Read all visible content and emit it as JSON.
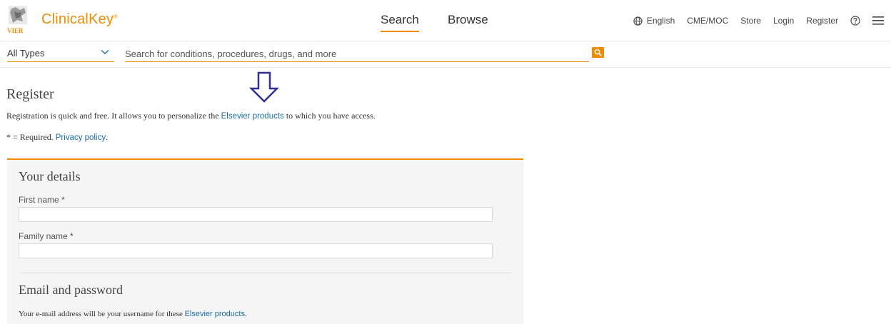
{
  "header": {
    "logo_text": "VIER",
    "brand": "ClinicalKey",
    "brand_mark": "®",
    "nav": {
      "search": "Search",
      "browse": "Browse"
    },
    "links": {
      "language": "English",
      "cme": "CME/MOC",
      "store": "Store",
      "login": "Login",
      "register": "Register"
    },
    "icons": {
      "globe": "globe-icon",
      "help": "help-icon",
      "menu": "menu-icon"
    }
  },
  "searchbar": {
    "type_value": "All Types",
    "placeholder": "Search for conditions, procedures, drugs, and more"
  },
  "page": {
    "title": "Register",
    "intro_before": "Registration is quick and free. It allows you to personalize the ",
    "intro_link": "Elsevier products",
    "intro_after": " to which you have access.",
    "required_prefix": "* = Required. ",
    "privacy_link": "Privacy policy",
    "required_suffix": "."
  },
  "form": {
    "details_title": "Your details",
    "first_name_label": "First name *",
    "family_name_label": "Family name *",
    "email_title": "Email and password",
    "email_note_before": "Your e-mail address will be your username for these ",
    "email_note_link": "Elsevier products",
    "email_note_after": "."
  },
  "colors": {
    "accent": "#ef8c00",
    "link": "#1a6d9e",
    "annotation_arrow": "#2e3192"
  }
}
